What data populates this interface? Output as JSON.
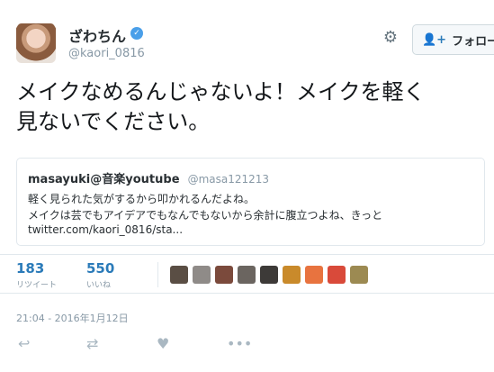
{
  "author": {
    "name": "ざわちん",
    "handle": "@kaori_0816",
    "verified_icon": "verified-badge-icon",
    "avatar_icon": "profile-avatar"
  },
  "actions_top": {
    "settings_icon": "gear-icon",
    "follow_icon": "person-add-icon",
    "follow_label": "フォロー"
  },
  "tweet": {
    "line1": "メイクなめるんじゃないよ！メイクを軽く",
    "line2": "見ないでください。"
  },
  "quote": {
    "name": "masayuki@音楽youtube",
    "handle": "@masa121213",
    "line1": "軽く見られた気がするから叩かれるんだよね。",
    "line2": "メイクは芸でもアイデアでもなんでもないから余計に腹立つよね、きっと",
    "line3": "twitter.com/kaori_0816/sta..."
  },
  "stats": {
    "retweets": "183",
    "retweets_label": "リツイート",
    "likes": "550",
    "likes_label": "いいね"
  },
  "likers": [
    {
      "color": "#5a4e44"
    },
    {
      "color": "#8f8b88"
    },
    {
      "color": "#7b4a3c"
    },
    {
      "color": "#6b6560"
    },
    {
      "color": "#3d3a38"
    },
    {
      "color": "#c98a2b"
    },
    {
      "color": "#e8733f"
    },
    {
      "color": "#d94a3a"
    },
    {
      "color": "#9c8a52"
    }
  ],
  "timestamp": "21:04 - 2016年1月12日",
  "bottom_actions": {
    "reply_icon": "reply-icon",
    "retweet_icon": "retweet-icon",
    "like_icon": "heart-icon",
    "more_icon": "more-icon"
  },
  "colors": {
    "accent": "#2b7bb9",
    "muted": "#8899a6",
    "border": "#e1e8ed"
  }
}
